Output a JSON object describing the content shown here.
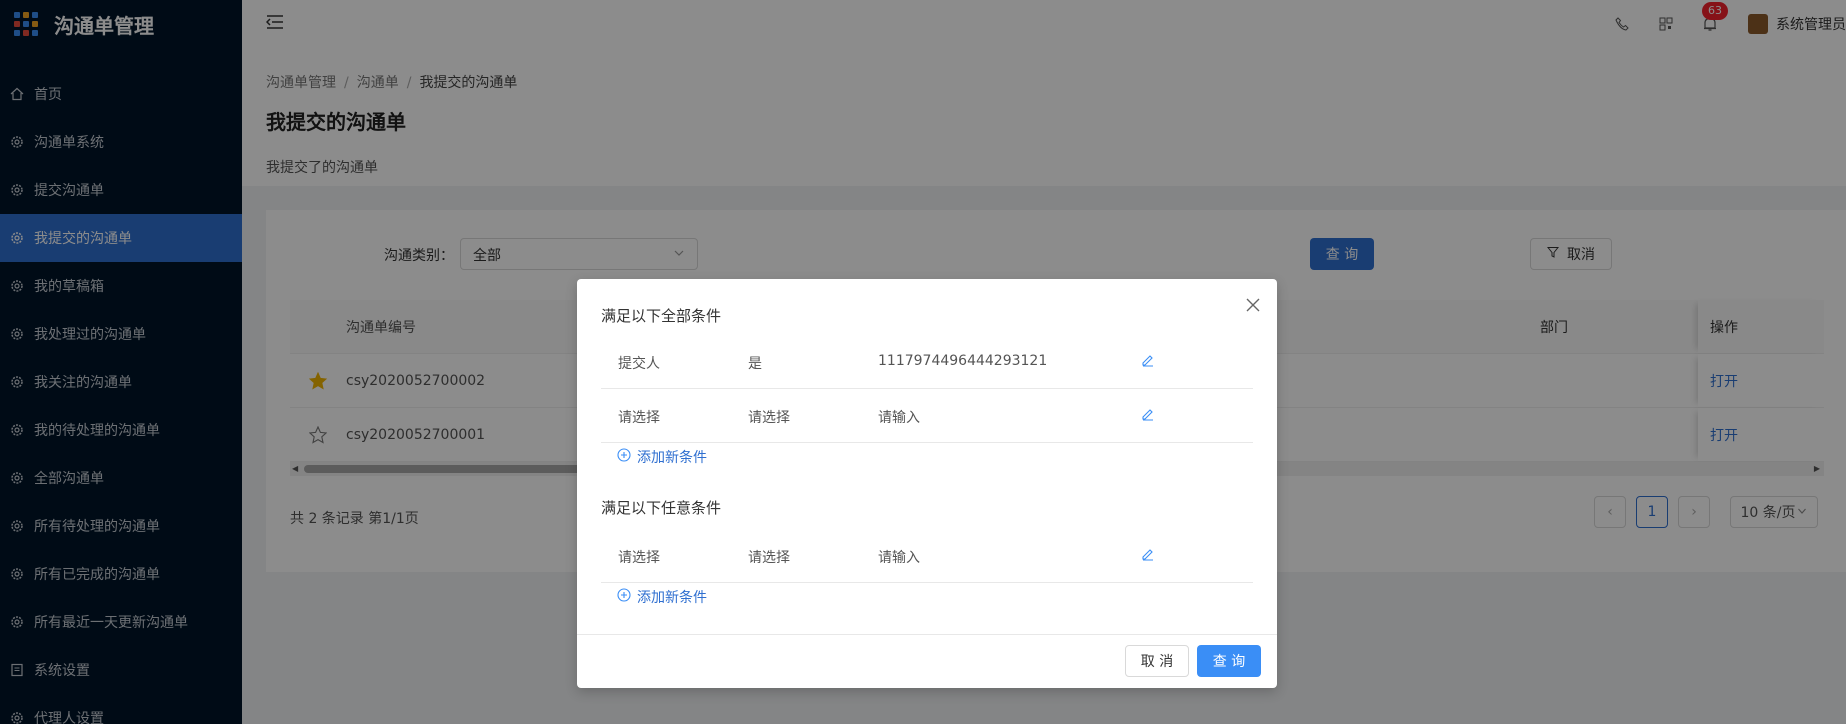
{
  "app": {
    "title": "沟通单管理"
  },
  "sidebar": {
    "items": [
      {
        "label": "首页",
        "icon": "home-icon"
      },
      {
        "label": "沟通单系统",
        "icon": "gear-icon"
      },
      {
        "label": "提交沟通单",
        "icon": "gear-icon"
      },
      {
        "label": "我提交的沟通单",
        "icon": "gear-icon",
        "active": true
      },
      {
        "label": "我的草稿箱",
        "icon": "gear-icon"
      },
      {
        "label": "我处理过的沟通单",
        "icon": "gear-icon"
      },
      {
        "label": "我关注的沟通单",
        "icon": "gear-icon"
      },
      {
        "label": "我的待处理的沟通单",
        "icon": "gear-icon"
      },
      {
        "label": "全部沟通单",
        "icon": "gear-icon"
      },
      {
        "label": "所有待处理的沟通单",
        "icon": "gear-icon"
      },
      {
        "label": "所有已完成的沟通单",
        "icon": "gear-icon"
      },
      {
        "label": "所有最近一天更新沟通单",
        "icon": "gear-icon"
      },
      {
        "label": "系统设置",
        "icon": "document-icon"
      },
      {
        "label": "代理人设置",
        "icon": "gear-icon"
      }
    ]
  },
  "header": {
    "badge_count": "63",
    "user_name": "系统管理员"
  },
  "page": {
    "breadcrumb": [
      "沟通单管理",
      "沟通单",
      "我提交的沟通单"
    ],
    "title": "我提交的沟通单",
    "description": "我提交了的沟通单"
  },
  "filter": {
    "label": "沟通类别：",
    "select_value": "全部",
    "query_label": "查 询",
    "cancel_label": "取消"
  },
  "table": {
    "columns": {
      "id": "沟通单编号",
      "dept": "部门",
      "op": "操作"
    },
    "rows": [
      {
        "id": "csy2020052700002",
        "starred": true,
        "op": "打开"
      },
      {
        "id": "csy2020052700001",
        "starred": false,
        "op": "打开"
      }
    ],
    "total": "共 2 条记录 第1/1页",
    "current_page": "1",
    "page_size": "10 条/页"
  },
  "modal": {
    "group_all_title": "满足以下全部条件",
    "group_any_title": "满足以下任意条件",
    "all_conditions": [
      {
        "field": "提交人",
        "op": "是",
        "value": "1117974496444293121"
      },
      {
        "field": "请选择",
        "op": "请选择",
        "value": "请输入"
      }
    ],
    "any_conditions": [
      {
        "field": "请选择",
        "op": "请选择",
        "value": "请输入"
      }
    ],
    "add_condition": "添加新条件",
    "cancel": "取 消",
    "query": "查 询"
  },
  "colors": {
    "sidebar_bg": "#001529",
    "accent": "#2f6fd0",
    "modal_primary": "#3a8ef6"
  }
}
